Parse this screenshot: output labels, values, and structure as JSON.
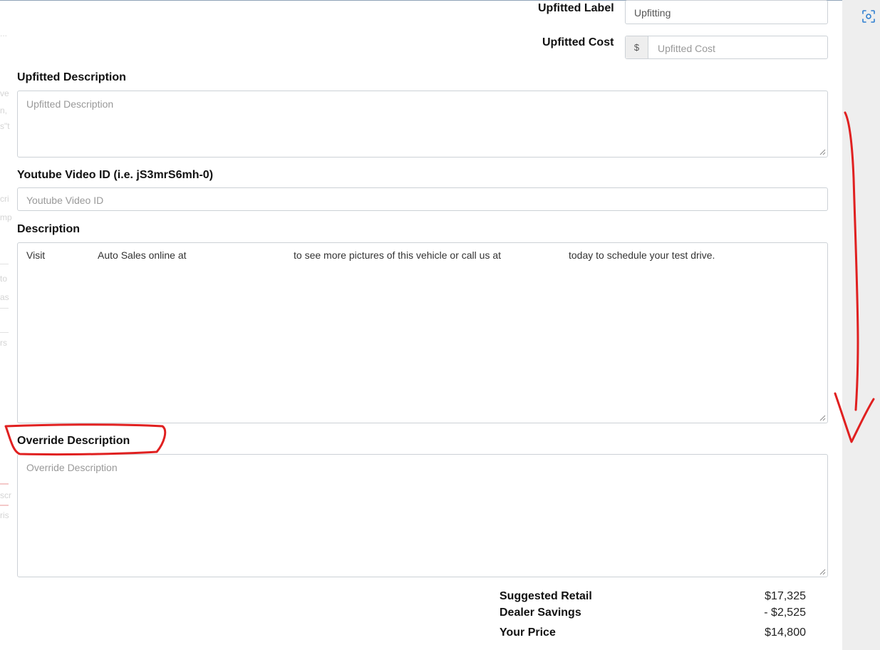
{
  "upfitted_label": {
    "label": "Upfitted Label",
    "value": "Upfitting"
  },
  "upfitted_cost": {
    "label": "Upfitted Cost",
    "prefix": "$",
    "placeholder": "Upfitted Cost"
  },
  "upfitted_description": {
    "label": "Upfitted Description",
    "placeholder": "Upfitted Description"
  },
  "youtube": {
    "label": "Youtube Video ID (i.e. jS3mrS6mh-0)",
    "placeholder": "Youtube Video ID"
  },
  "description": {
    "label": "Description",
    "parts": [
      "Visit",
      "Auto Sales online at",
      "to see more pictures of this vehicle or call us at",
      "today to schedule your test drive."
    ]
  },
  "override_description": {
    "label": "Override Description",
    "placeholder": "Override Description"
  },
  "pricing": {
    "suggested_retail": {
      "label": "Suggested Retail",
      "value": "$17,325"
    },
    "dealer_savings": {
      "label": "Dealer Savings",
      "value": "- $2,525"
    },
    "your_price": {
      "label": "Your Price",
      "value": "$14,800"
    }
  },
  "icons": {
    "scan": "screen-capture-icon",
    "resize": "resize-grip-icon"
  },
  "colors": {
    "annotation": "#e02020",
    "border": "#ccd1d6",
    "scroll_track": "#eeeeee"
  }
}
